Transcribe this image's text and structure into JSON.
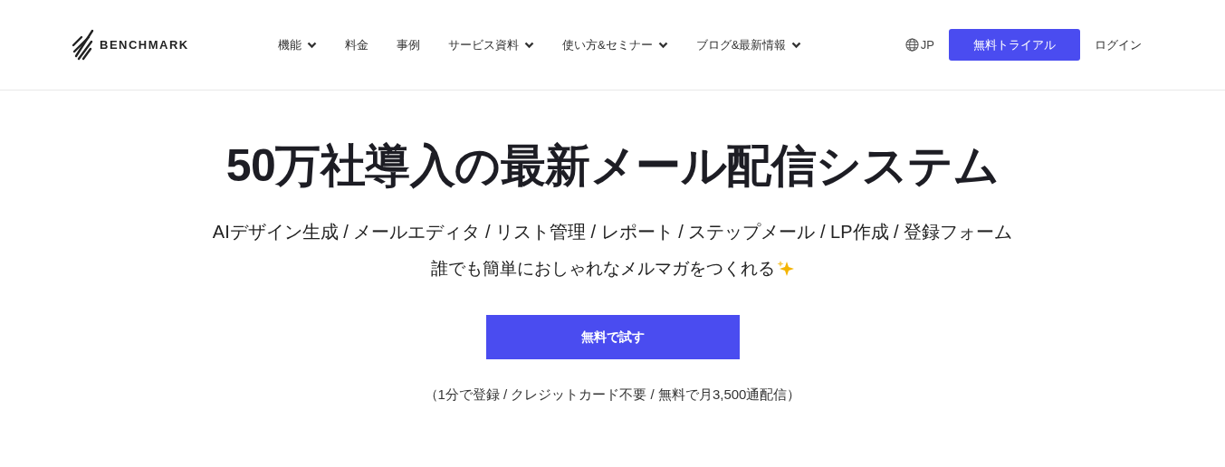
{
  "header": {
    "logo": "BENCHMARK",
    "nav": [
      {
        "label": "機能",
        "dropdown": true
      },
      {
        "label": "料金",
        "dropdown": false
      },
      {
        "label": "事例",
        "dropdown": false
      },
      {
        "label": "サービス資料",
        "dropdown": true
      },
      {
        "label": "使い方&セミナー",
        "dropdown": true
      },
      {
        "label": "ブログ&最新情報",
        "dropdown": true
      }
    ],
    "language": "JP",
    "trial_button": "無料トライアル",
    "login": "ログイン"
  },
  "hero": {
    "title": "50万社導入の最新メール配信システム",
    "features": "AIデザイン生成 / メールエディタ / リスト管理 / レポート / ステップメール / LP作成 / 登録フォーム",
    "tagline": "誰でも簡単におしゃれなメルマガをつくれる",
    "cta_button": "無料で試す",
    "note": "（1分で登録 / クレジットカード不要 / 無料で月3,500通配信）"
  }
}
